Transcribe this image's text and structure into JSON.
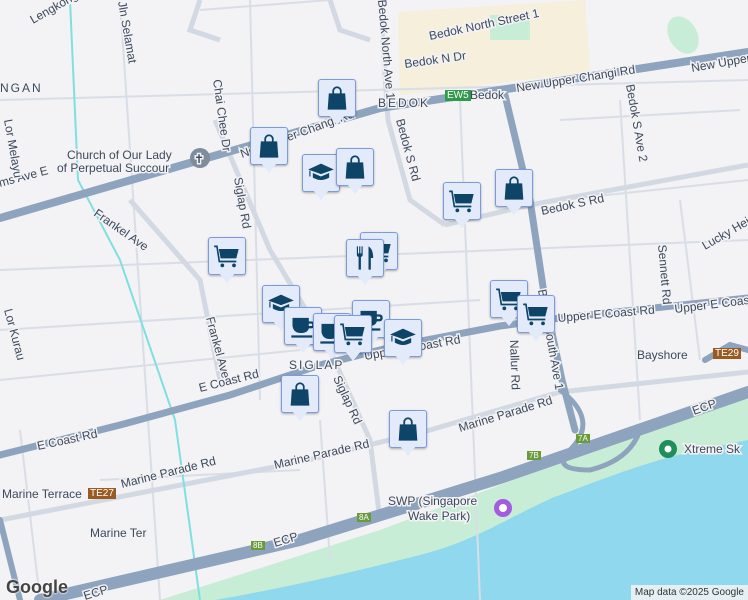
{
  "map": {
    "labels": {
      "bedok_north_st1": "Bedok North Street 1",
      "bedok_n_dr": "Bedok N Dr",
      "bedok_north_ave1": "Bedok North Ave 1",
      "bedok_area": "BEDOK",
      "bedok_station": "Bedok",
      "new_upper_changi_rd": "New Upper Changi Rd",
      "new_upper_changi_rd_2": "New Upper Changi Rd",
      "new_upper_changi_rd_3": "New Upper Changi Rd",
      "bedok_s_rd": "Bedok S Rd",
      "bedok_s_rd_2": "Bedok S Rd",
      "bedok_s_ave2": "Bedok S Ave 2",
      "lucky_heights": "Lucky Heights",
      "sennett_rd": "Sennett Rd",
      "upper_e_coast_rd": "Upper E Coast Rd",
      "upper_e_coast_rd_2": "Upper E Coast Rd",
      "upper_e_coast_rd_3": "Upper E Coast Rd",
      "bedok_south_ave1": "Bedok South Ave 1",
      "nallur_rd": "Nallur Rd",
      "bayshore": "Bayshore",
      "siglap": "SIGLAP",
      "siglap_rd": "Siglap Rd",
      "siglap_rd_2": "Siglap Rd",
      "chai_chee_dr": "Chai Chee Dr",
      "frankel_ave": "Frankel Ave",
      "frankel_ave_2": "Frankel Ave",
      "e_coast_rd": "E Coast Rd",
      "e_coast_rd_2": "E Coast Rd",
      "marine_parade_rd": "Marine Parade Rd",
      "marine_parade_rd_2": "Marine Parade Rd",
      "marine_parade_rd_3": "Marine Parade Rd",
      "marine_terrace": "Marine Terrace",
      "marine_ter": "Marine Ter",
      "ecp": "ECP",
      "ecp_2": "ECP",
      "ecp_3": "ECP",
      "church": "Church of Our Lady",
      "church_2": "of Perpetual Succour",
      "williams_ave": "ms Ave E",
      "jln_selamat": "Jln Selamat",
      "lengkong": "Lengkong",
      "kembangan": "NGAN",
      "lor_melayu": "Lor Melayu",
      "lor_kurau": "Lor Kurau",
      "swp": "SWP (Singapore",
      "swp_2": "Wake Park)",
      "xtreme": "Xtreme Sk"
    },
    "badges": {
      "ew5": "EW5",
      "te27": "TE27",
      "te29": "TE29",
      "exit_7a": "7A",
      "exit_7b": "7B",
      "exit_8a": "8A",
      "exit_8b": "8B"
    },
    "colors": {
      "water": "#8fd8ee",
      "park": "#c8edd6",
      "road_major": "#8ea3bd",
      "road_minor": "#d2d9e2",
      "town": "#f5efdc",
      "marker_fill": "#e3ebfb",
      "marker_icon": "#0e4468",
      "mrt": "#2e9a4a",
      "lrt": "#9a5b22"
    },
    "attribution": "Map data ©2025 Google",
    "logo": "Google"
  }
}
